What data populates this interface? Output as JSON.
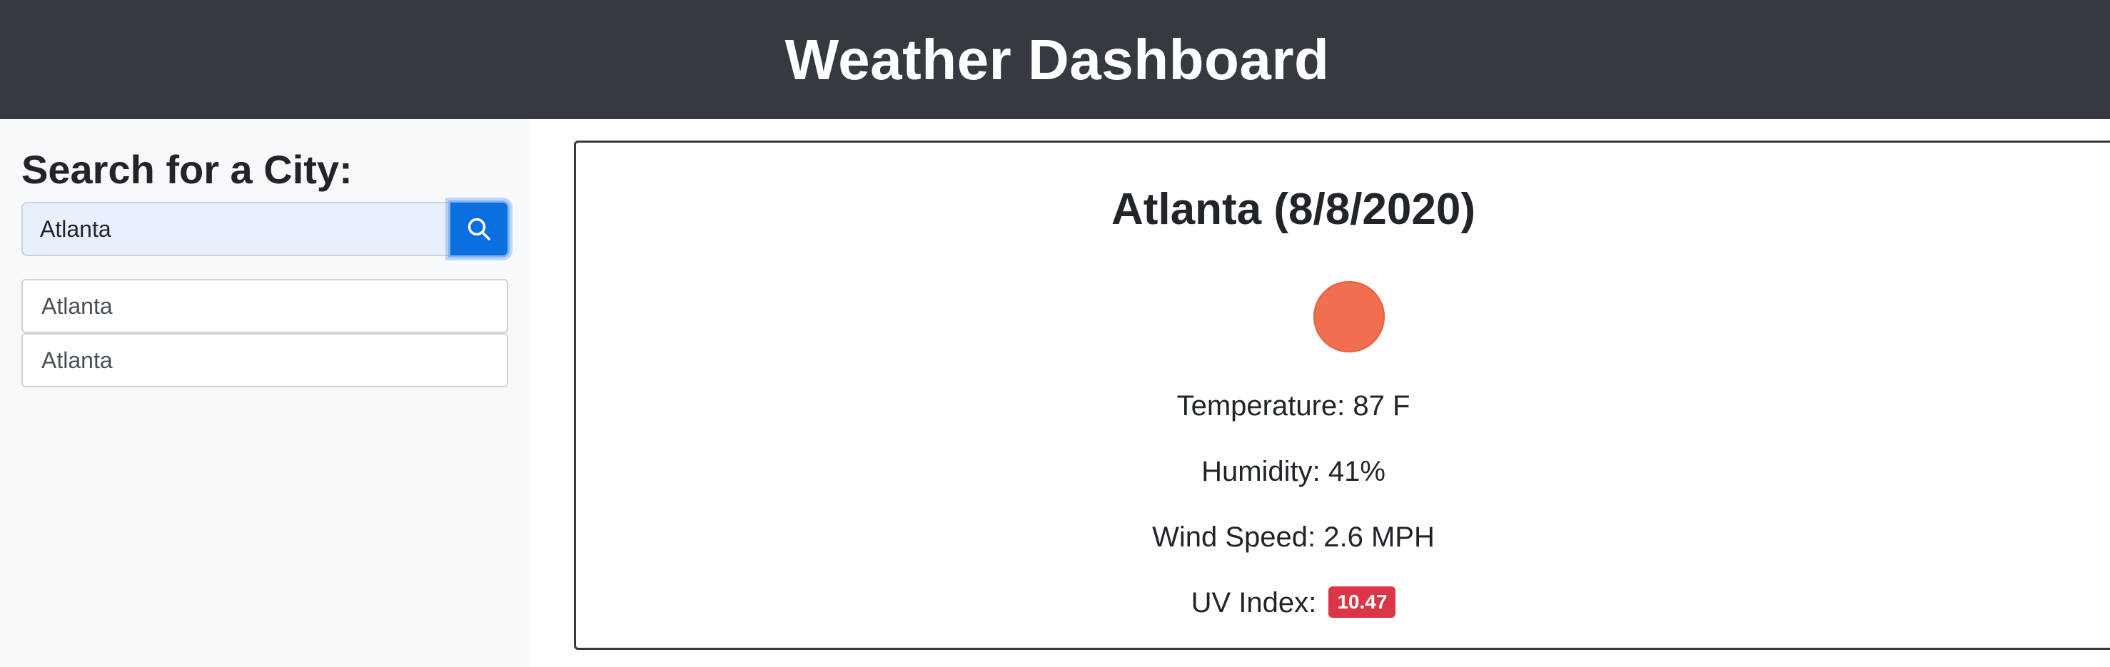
{
  "header": {
    "title": "Weather Dashboard"
  },
  "sidebar": {
    "heading": "Search for a City:",
    "search": {
      "value": "Atlanta",
      "button_icon": "search-icon"
    },
    "history": [
      {
        "label": "Atlanta"
      },
      {
        "label": "Atlanta"
      }
    ]
  },
  "current": {
    "heading": "Atlanta (8/8/2020)",
    "icon": "sun-icon",
    "temperature": "Temperature: 87 F",
    "humidity": "Humidity: 41%",
    "wind": "Wind Speed: 2.6 MPH",
    "uv_label": "UV Index:",
    "uv_value": "10.47"
  },
  "colors": {
    "header_bg": "#343a40",
    "sidebar_bg": "#f8f9fa",
    "primary": "#0b6fe0",
    "uv_danger": "#dc3545",
    "sun": "#ef6f50"
  }
}
